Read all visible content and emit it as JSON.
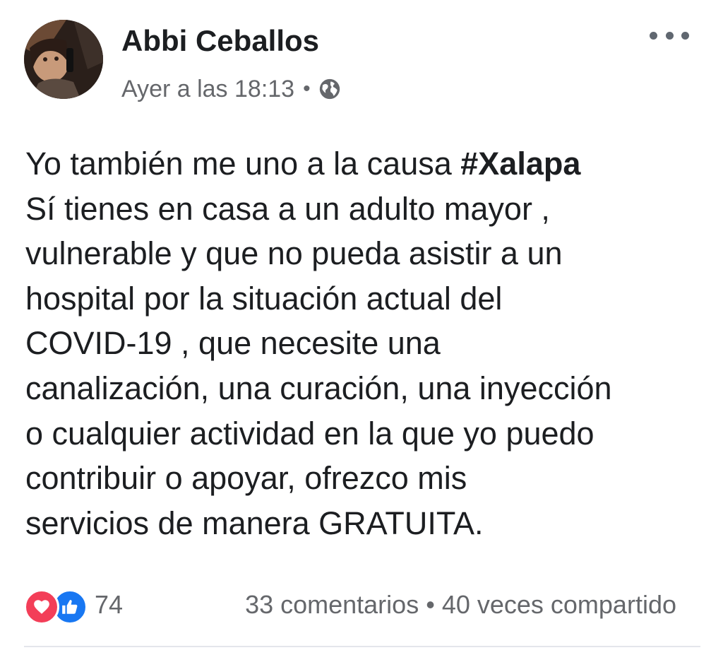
{
  "post": {
    "author": "Abbi Ceballos",
    "timestamp": "Ayer a las 18:13",
    "separator": "•",
    "privacy_icon": "globe-icon",
    "more_icon": "more-options-icon",
    "message_lines": [
      {
        "text": "Yo también me uno a la causa ",
        "hashtag": "#Xalapa"
      },
      {
        "text": "Sí tienes en casa a un adulto mayor ,"
      },
      {
        "text": "vulnerable y que no pueda asistir a un"
      },
      {
        "text": "hospital por la situación actual del"
      },
      {
        "text": "COVID-19 , que necesite una"
      },
      {
        "text": "canalización, una curación, una inyección"
      },
      {
        "text": "o cualquier actividad en la que yo puedo"
      },
      {
        "text": "contribuir o apoyar, ofrezco mis"
      },
      {
        "text": "servicios de manera GRATUITA."
      }
    ]
  },
  "reactions": {
    "icons": [
      "love-reaction-icon",
      "like-reaction-icon"
    ],
    "count": "74",
    "comments": "33 comentarios",
    "separator": "•",
    "shares": "40 veces compartido"
  },
  "colors": {
    "text": "#1c1e21",
    "secondary_text": "#65676b",
    "love": "#f33e58",
    "like": "#1877f2",
    "divider": "#e4e6eb"
  }
}
